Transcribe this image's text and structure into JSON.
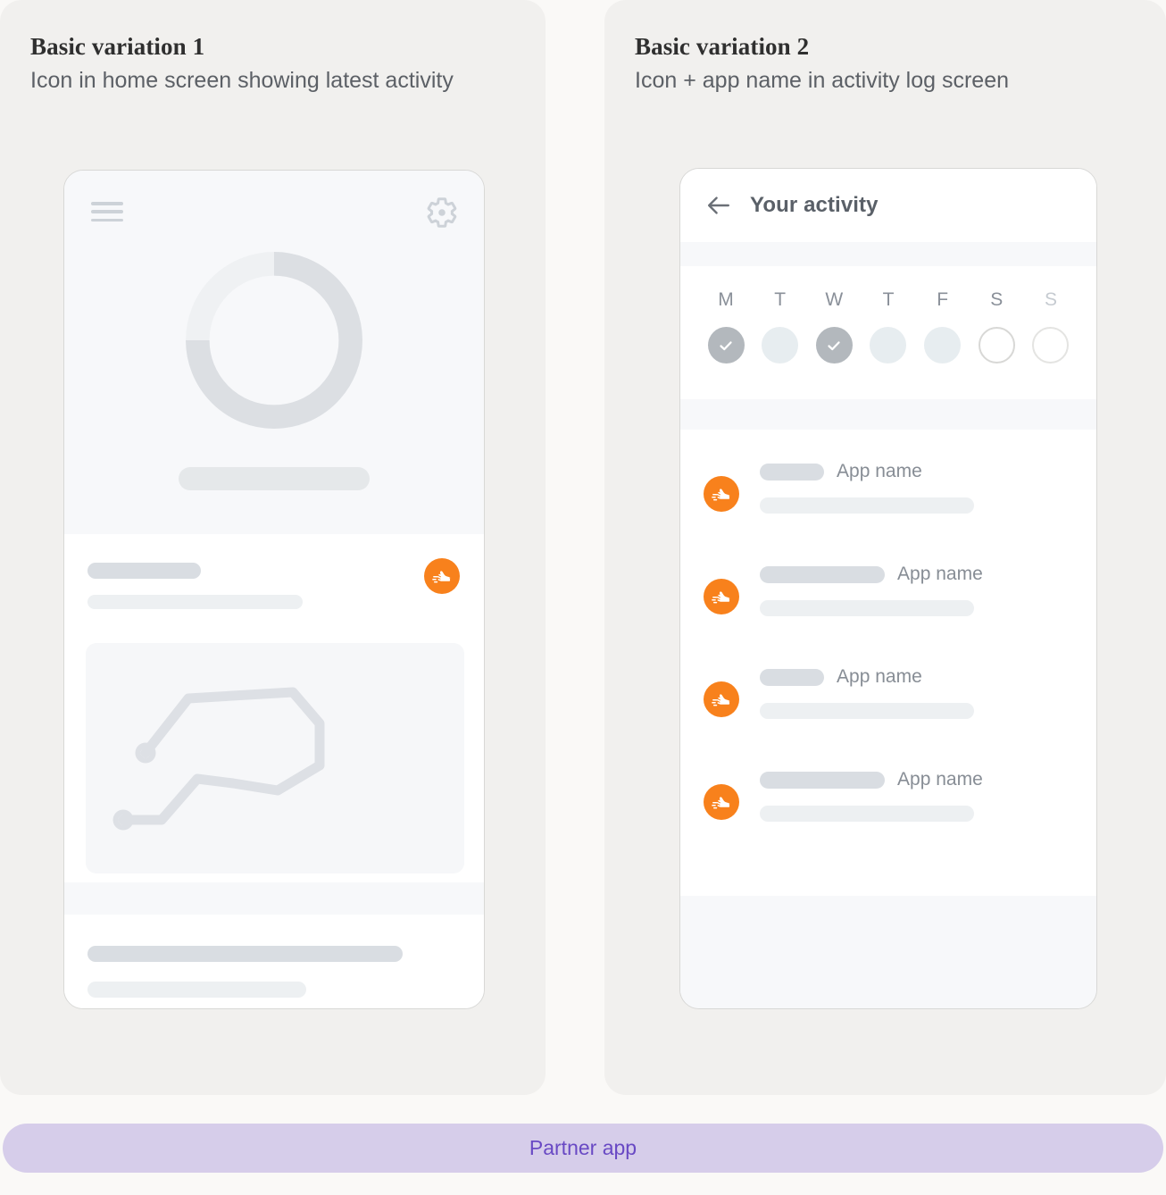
{
  "page": {
    "background": "#faf9f7"
  },
  "panels": [
    {
      "title": "Basic variation 1",
      "subtitle": "Icon in home screen showing latest activity"
    },
    {
      "title": "Basic variation 2",
      "subtitle": "Icon + app name in activity log screen"
    }
  ],
  "phone1": {
    "menu_icon": "hamburger-menu-icon",
    "settings_icon": "gear-icon",
    "progress_ring": {
      "track_color": "#eff1f3",
      "value_color": "#dcdfe3",
      "percent": 75
    },
    "activity_badge_icon": "running-shoe-icon",
    "route_map_icon": "route-path-icon"
  },
  "phone2": {
    "back_icon": "back-arrow-icon",
    "title": "Your activity",
    "days": [
      {
        "label": "M",
        "state": "done"
      },
      {
        "label": "T",
        "state": "soft"
      },
      {
        "label": "W",
        "state": "done"
      },
      {
        "label": "T",
        "state": "soft"
      },
      {
        "label": "F",
        "state": "soft"
      },
      {
        "label": "S",
        "state": "empty"
      },
      {
        "label": "S",
        "state": "empty-light"
      }
    ],
    "check_icon": "check-icon",
    "activities": [
      {
        "icon": "running-shoe-icon",
        "pill_width": 72,
        "app_name": "App name",
        "sub_width": 240
      },
      {
        "icon": "running-shoe-icon",
        "pill_width": 140,
        "app_name": "App name",
        "sub_width": 240
      },
      {
        "icon": "running-shoe-icon",
        "pill_width": 72,
        "app_name": "App name",
        "sub_width": 240
      },
      {
        "icon": "running-shoe-icon",
        "pill_width": 140,
        "app_name": "App name",
        "sub_width": 240
      }
    ]
  },
  "footer": {
    "label": "Partner app",
    "background": "#d6cdea",
    "text_color": "#6949c4"
  },
  "colors": {
    "brand_orange": "#f8811c",
    "panel_bg": "#f1f0ee",
    "screen_bg": "#f7f8fa"
  }
}
